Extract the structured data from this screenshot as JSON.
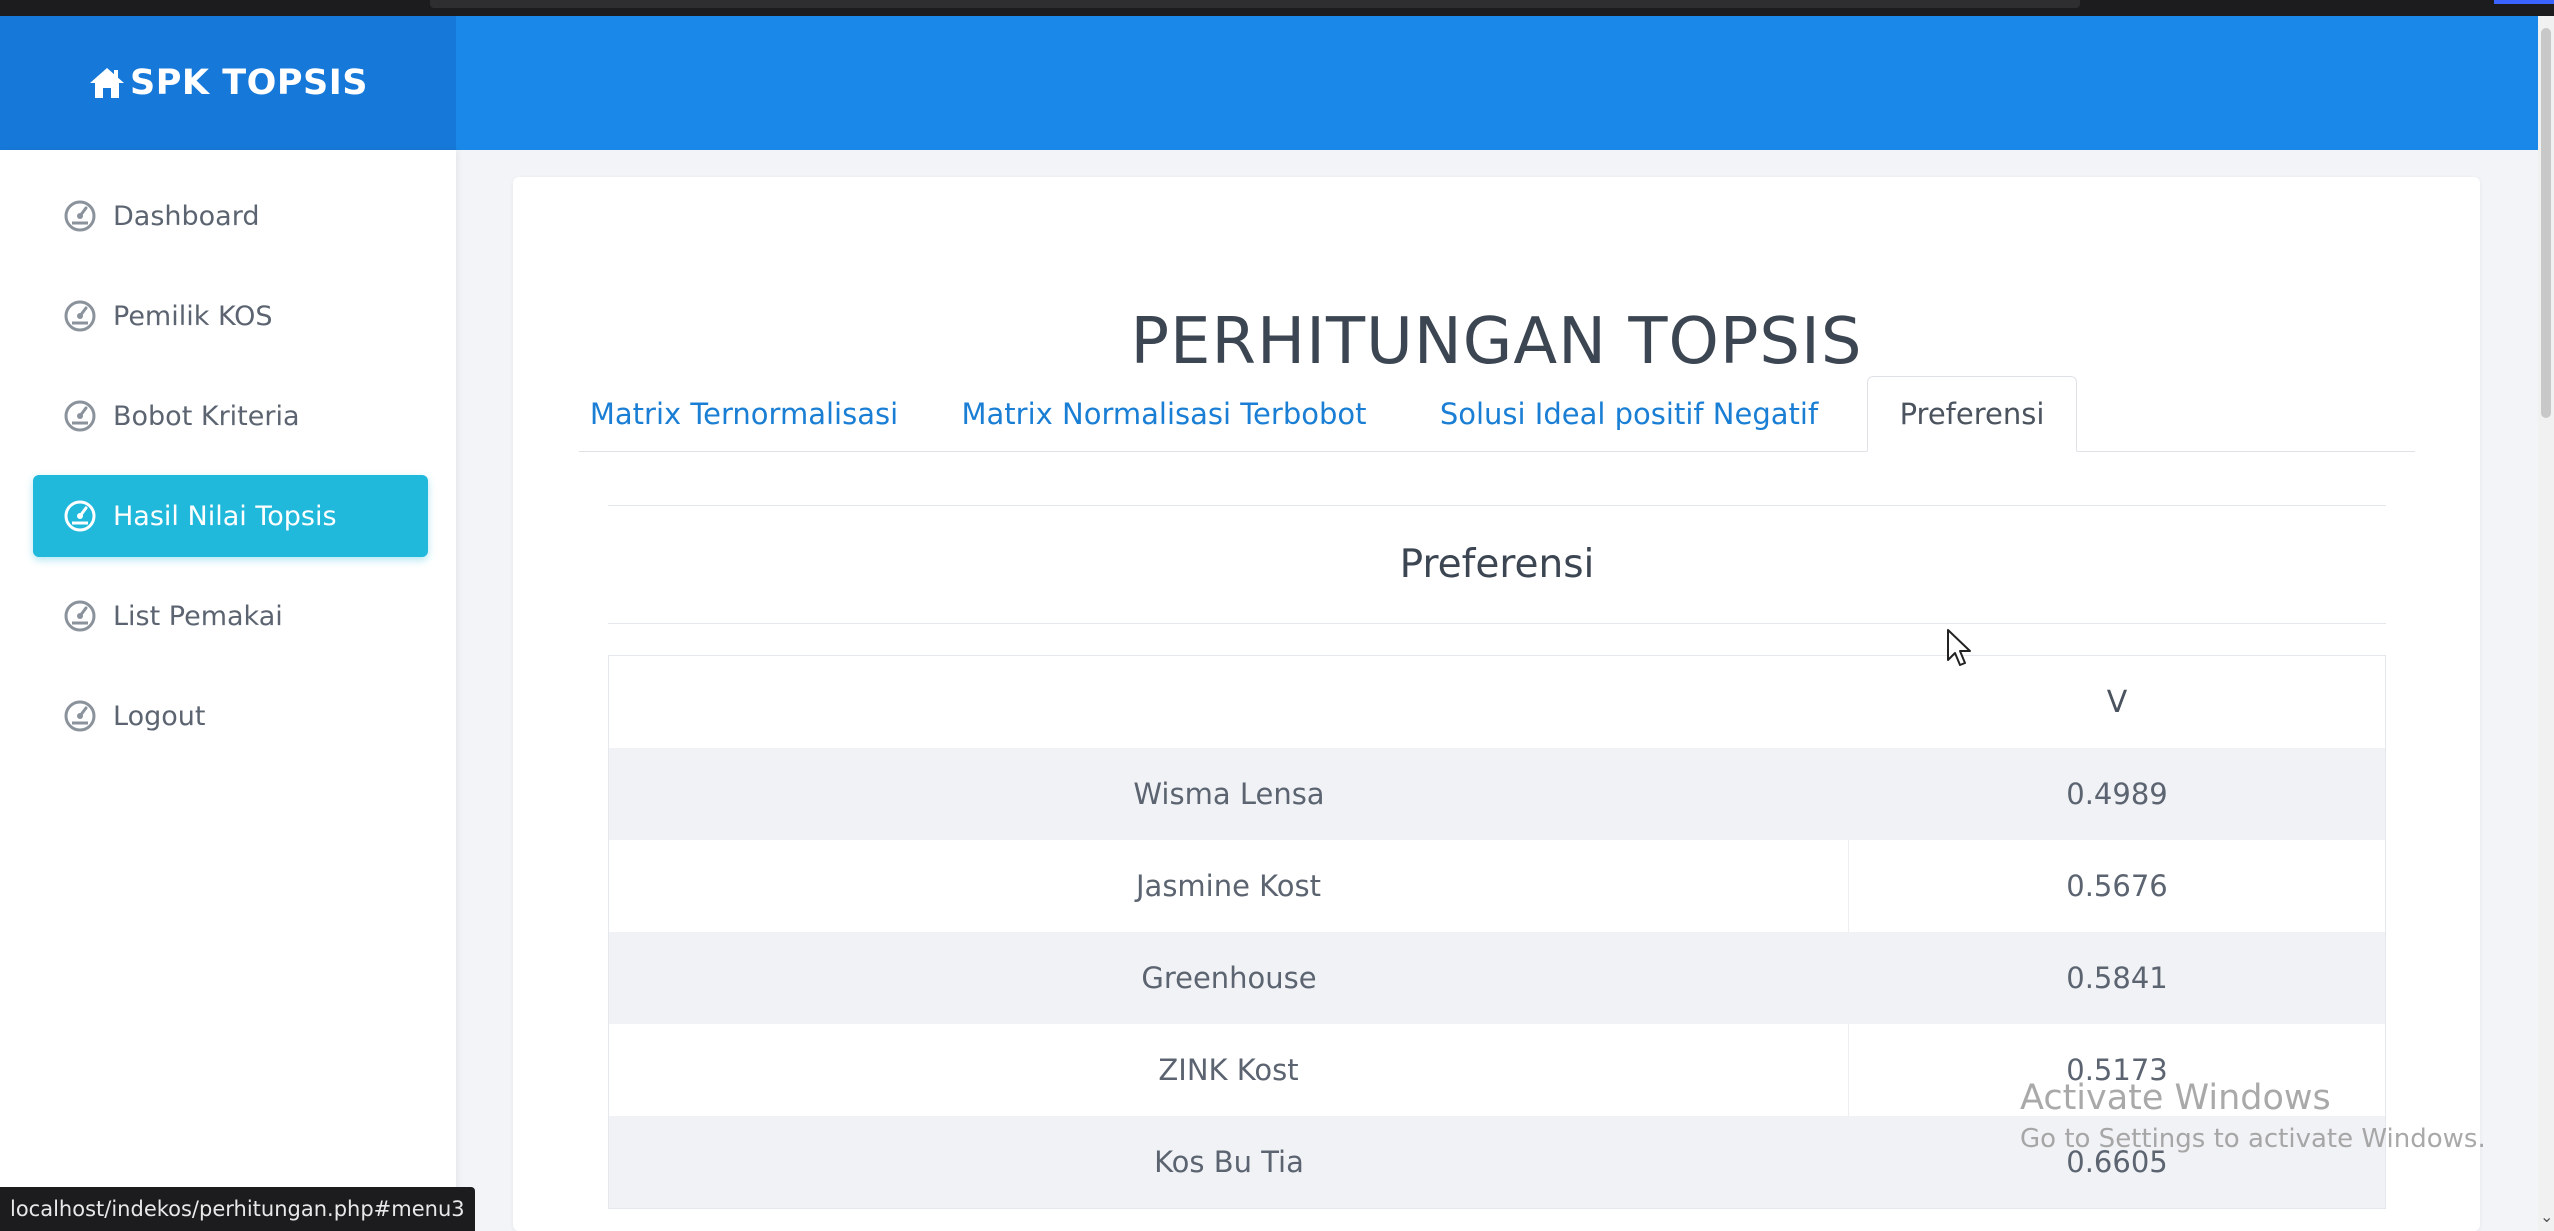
{
  "brand": {
    "title": "SPK TOPSIS"
  },
  "sidebar": {
    "items": [
      {
        "label": "Dashboard"
      },
      {
        "label": "Pemilik KOS"
      },
      {
        "label": "Bobot Kriteria"
      },
      {
        "label": "Hasil Nilai Topsis"
      },
      {
        "label": "List Pemakai"
      },
      {
        "label": "Logout"
      }
    ]
  },
  "main": {
    "title": "PERHITUNGAN TOPSIS",
    "tabs": [
      {
        "label": "Matrix Ternormalisasi"
      },
      {
        "label": "Matrix Normalisasi Terbobot"
      },
      {
        "label": "Solusi Ideal positif Negatif"
      },
      {
        "label": "Preferensi"
      }
    ],
    "section_title": "Preferensi",
    "table": {
      "headers": [
        "",
        "V"
      ],
      "rows": [
        {
          "name": "Wisma Lensa",
          "value": "0.4989"
        },
        {
          "name": "Jasmine Kost",
          "value": "0.5676"
        },
        {
          "name": "Greenhouse",
          "value": "0.5841"
        },
        {
          "name": "ZINK Kost",
          "value": "0.5173"
        },
        {
          "name": "Kos Bu Tia",
          "value": "0.6605"
        }
      ]
    }
  },
  "statusbar": {
    "url": "localhost/indekos/perhitungan.php#menu3"
  },
  "watermark": {
    "title": "Activate Windows",
    "subtitle": "Go to Settings to activate Windows."
  },
  "colors": {
    "header": "#1a88e8",
    "brand_bg": "#1679d9",
    "active_nav": "#20b8db",
    "tab_link": "#1a7fd4"
  }
}
